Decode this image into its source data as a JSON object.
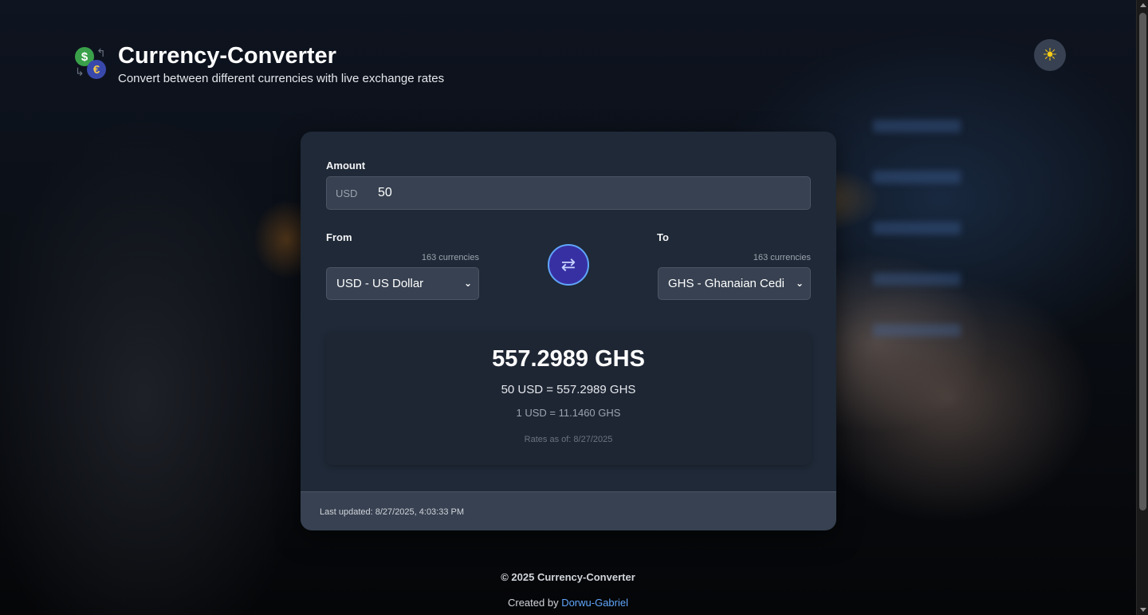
{
  "header": {
    "title": "Currency-Converter",
    "subtitle": "Convert between different currencies with live exchange rates",
    "logo_icon": "currency-exchange-icon",
    "theme_icon": "sun-icon"
  },
  "converter": {
    "amount_label": "Amount",
    "amount_currency": "USD",
    "amount_value": "50",
    "from_label": "From",
    "to_label": "To",
    "from_count": "163 currencies",
    "to_count": "163 currencies",
    "from_selected": "USD - US Dollar",
    "to_selected": "GHS - Ghanaian Cedi",
    "swap_icon": "swap-arrows-icon"
  },
  "result": {
    "converted": "557.2989 GHS",
    "equation": "50 USD = 557.2989 GHS",
    "rate": "1 USD = 11.1460 GHS",
    "rates_as_of": "Rates as of: 8/27/2025"
  },
  "card_footer": {
    "last_updated": "Last updated: 8/27/2025, 4:03:33 PM"
  },
  "page_footer": {
    "copyright": "© 2025 Currency-Converter",
    "credit_prefix": "Created by ",
    "credit_link": "Dorwu-Gabriel"
  },
  "colors": {
    "card_bg": "#1f2937",
    "accent": "#60a5fa",
    "swap_button": "#3730a3",
    "sun": "#facc15"
  }
}
